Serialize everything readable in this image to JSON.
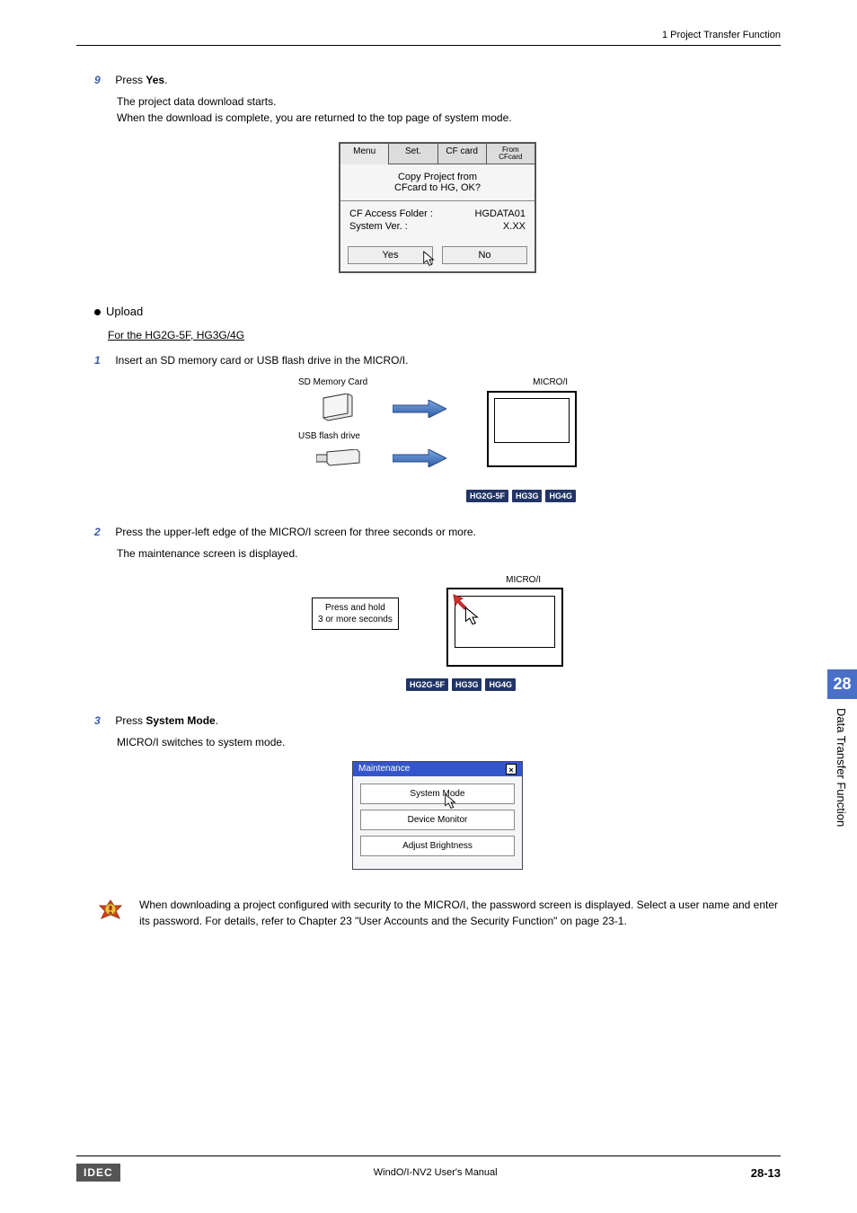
{
  "header": {
    "right": "1 Project Transfer Function"
  },
  "steps": {
    "s9": {
      "num": "9",
      "lead": "Press ",
      "bold": "Yes",
      "tail": ".",
      "body1": "The project data download starts.",
      "body2": "When the download is complete, you are returned to the top page of system mode."
    },
    "s1": {
      "num": "1",
      "text": "Insert an SD memory card or USB flash drive in the MICRO/I."
    },
    "s2": {
      "num": "2",
      "text": "Press the upper-left edge of the MICRO/I screen for three seconds or more.",
      "body": "The maintenance screen is displayed."
    },
    "s3": {
      "num": "3",
      "lead": "Press ",
      "bold": "System Mode",
      "tail": ".",
      "body": "MICRO/I switches to system mode."
    }
  },
  "dialog": {
    "tabs": {
      "menu": "Menu",
      "set": "Set.",
      "cf": "CF card",
      "from1": "From",
      "from2": "CFcard"
    },
    "line1": "Copy Project from",
    "line2": "CFcard to HG, OK?",
    "info1l": "CF Access Folder :",
    "info1r": "HGDATA01",
    "info2l": "System Ver. :",
    "info2r": "X.XX",
    "yes": "Yes",
    "no": "No"
  },
  "upload": {
    "heading": "Upload",
    "sub": "For the HG2G-5F, HG3G/4G"
  },
  "fig1": {
    "sd": "SD Memory Card",
    "micro": "MICRO/I",
    "usb": "USB flash drive",
    "b1": "HG2G-5F",
    "b2": "HG3G",
    "b3": "HG4G"
  },
  "fig2": {
    "micro": "MICRO/I",
    "l1": "Press and hold",
    "l2": "3 or more seconds",
    "b1": "HG2G-5F",
    "b2": "HG3G",
    "b3": "HG4G"
  },
  "maint": {
    "title": "Maintenance",
    "b1": "System Mode",
    "b2": "Device Monitor",
    "b3": "Adjust Brightness"
  },
  "alert": {
    "text": "When downloading a project configured with security to the MICRO/I, the password screen is displayed. Select a user name and enter its password. For details, refer to Chapter 23 \"User Accounts and the Security Function\" on page 23-1."
  },
  "sidebar": {
    "num": "28",
    "text": "Data Transfer Function"
  },
  "footer": {
    "logo": "IDEC",
    "center": "WindO/I-NV2 User's Manual",
    "page": "28-13"
  }
}
